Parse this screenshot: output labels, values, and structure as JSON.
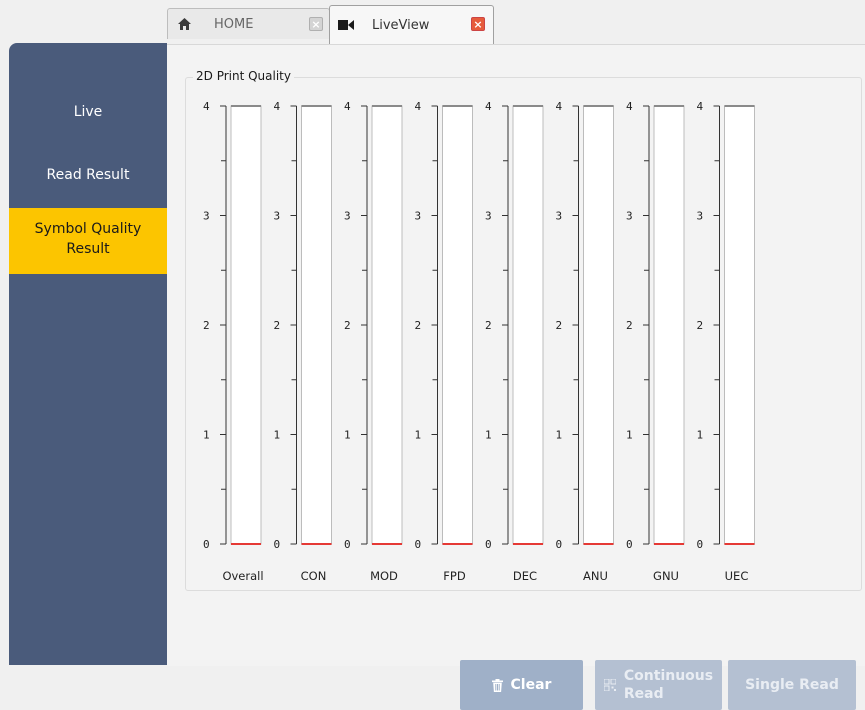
{
  "tabs": [
    {
      "label": "HOME",
      "icon": "home-icon",
      "close": "×"
    },
    {
      "label": "LiveView",
      "icon": "video-camera-icon",
      "close": "×"
    }
  ],
  "sidebar": {
    "items": [
      {
        "label": "Live",
        "selected": false
      },
      {
        "label": "Read Result",
        "selected": false
      },
      {
        "label_line1": "Symbol Quality",
        "label_line2": "Result",
        "selected": true
      }
    ]
  },
  "panel": {
    "title": "2D Print Quality"
  },
  "buttons": {
    "clear": "Clear",
    "continuous_line1": "Continuous",
    "continuous_line2": "Read",
    "single": "Single Read"
  },
  "colors": {
    "sidebar": "#4a5b7b",
    "selected": "#fcc500",
    "bar_fill_marker": "#e53935"
  },
  "chart_data": {
    "type": "bar",
    "title": "2D Print Quality",
    "categories": [
      "Overall",
      "CON",
      "MOD",
      "FPD",
      "DEC",
      "ANU",
      "GNU",
      "UEC"
    ],
    "values": [
      0,
      0,
      0,
      0,
      0,
      0,
      0,
      0
    ],
    "ylim": [
      0,
      4
    ],
    "yticks": [
      "0",
      "1",
      "2",
      "3",
      "4"
    ],
    "grid": false
  }
}
